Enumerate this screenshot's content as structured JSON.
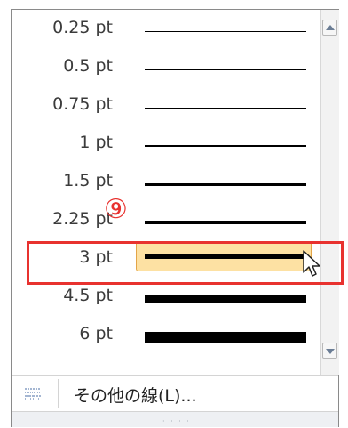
{
  "line_weights": [
    {
      "label": "0.25 pt",
      "thickness_pt": 0.25,
      "selected": false
    },
    {
      "label": "0.5 pt",
      "thickness_pt": 0.5,
      "selected": false
    },
    {
      "label": "0.75 pt",
      "thickness_pt": 0.75,
      "selected": false
    },
    {
      "label": "1 pt",
      "thickness_pt": 1,
      "selected": false
    },
    {
      "label": "1.5 pt",
      "thickness_pt": 1.5,
      "selected": false
    },
    {
      "label": "2.25 pt",
      "thickness_pt": 2.25,
      "selected": false
    },
    {
      "label": "3 pt",
      "thickness_pt": 3,
      "selected": true
    },
    {
      "label": "4.5 pt",
      "thickness_pt": 4.5,
      "selected": false
    },
    {
      "label": "6 pt",
      "thickness_pt": 6,
      "selected": false
    }
  ],
  "more_lines": {
    "label": "その他の線(L)...",
    "icon": "dashed-lines-icon"
  },
  "annotation": {
    "callout": "⑨",
    "color": "#e8322f"
  },
  "colors": {
    "highlight": "#fde1a3",
    "highlight_border": "#e3a548"
  }
}
